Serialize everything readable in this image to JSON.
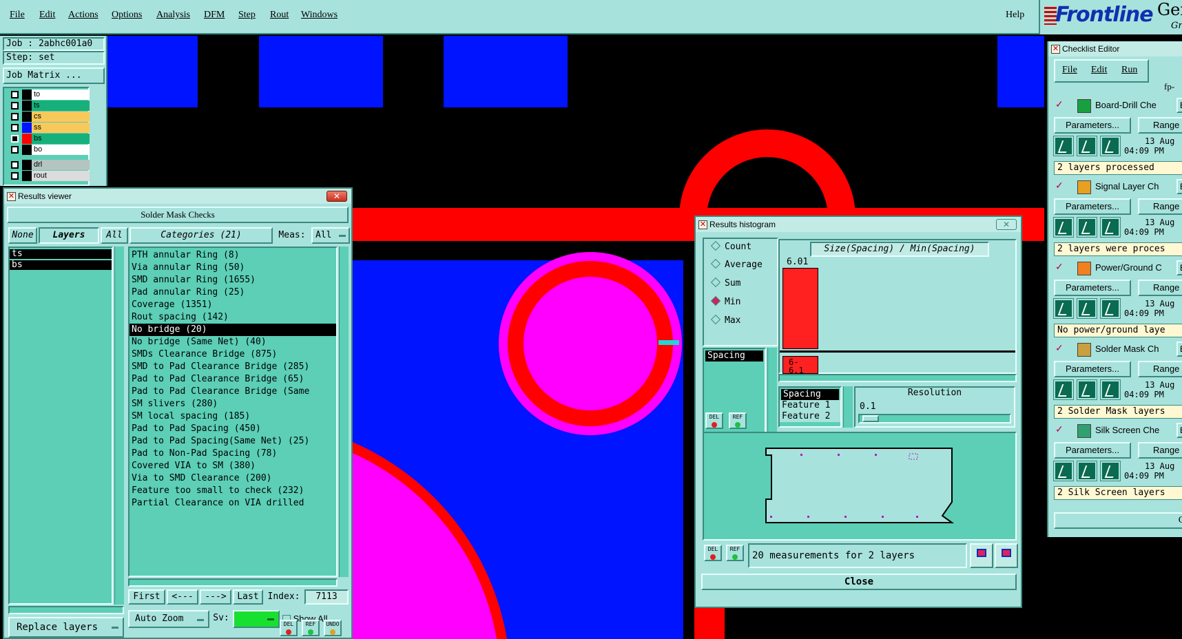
{
  "menubar": {
    "items": [
      "File",
      "Edit",
      "Actions",
      "Options",
      "Analysis",
      "DFM",
      "Step",
      "Rout",
      "Windows"
    ],
    "help": "Help"
  },
  "brand": {
    "logo": "Frontline",
    "gen": "Gen",
    "gr": "Gr"
  },
  "job": {
    "job_label": "Job : 2abhc001a0",
    "step_label": "Step: set",
    "matrix_button": "Job Matrix ..."
  },
  "layers": [
    {
      "name": "to",
      "color": "#ffffff"
    },
    {
      "name": "ts",
      "color": "#18b07a"
    },
    {
      "name": "cs",
      "color": "#f8c95a"
    },
    {
      "name": "ss",
      "color": "#f8c95a"
    },
    {
      "name": "bs",
      "color": "#18b07a"
    },
    {
      "name": "bo",
      "color": "#ffffff"
    },
    {
      "name": "drl",
      "color": "#b4c4c0"
    },
    {
      "name": "rout",
      "color": "#dcdcdc"
    }
  ],
  "results_viewer": {
    "title": "Results viewer",
    "header": "Solder Mask Checks",
    "none_btn": "None",
    "layers_btn": "Layers",
    "all_btn": "All",
    "categories_btn": "Categories (21)",
    "meas_label": "Meas:",
    "meas_value": "All",
    "layer_list": [
      "ts",
      "bs"
    ],
    "categories": [
      "PTH annular Ring (8)",
      "Via annular Ring (50)",
      "SMD annular Ring (1655)",
      "Pad annular Ring (25)",
      "Coverage (1351)",
      "Rout spacing (142)",
      "No bridge (20)",
      "No bridge (Same Net) (40)",
      "SMDs Clearance Bridge (875)",
      "SMD to Pad Clearance Bridge (285)",
      "Pad to Pad Clearance Bridge (65)",
      "Pad to Pad Clearance Bridge (Same",
      "SM slivers (280)",
      "SM local spacing (185)",
      "Pad to Pad Spacing (450)",
      "Pad to Pad Spacing(Same Net) (25)",
      "Pad to Non-Pad Spacing (78)",
      "Covered VIA to SM (380)",
      "Via to SMD Clearance (200)",
      "Feature too small to check (232)",
      "Partial Clearance on VIA drilled"
    ],
    "selected_category": "No bridge (20)",
    "nav": {
      "first": "First",
      "prev": "<---",
      "next": "--->",
      "last": "Last",
      "index_label": "Index:",
      "index_value": "7113"
    },
    "auto_zoom": "Auto Zoom",
    "sv_label": "Sv:",
    "show_all": "Show All",
    "replace_layers": "Replace layers",
    "del": "DEL",
    "ref": "REF",
    "undo": "UNDO"
  },
  "histogram": {
    "title": "Results histogram",
    "modes": [
      {
        "label": "Count",
        "on": false
      },
      {
        "label": "Average",
        "on": false
      },
      {
        "label": "Sum",
        "on": false
      },
      {
        "label": "Min",
        "on": true
      },
      {
        "label": "Max",
        "on": false
      }
    ],
    "measure_list": [
      "Spacing"
    ],
    "chart_title": "Size(Spacing) / Min(Spacing)",
    "bar_value_label": "6.01",
    "bin_label": "6-\n6.1",
    "axis_list": [
      "Spacing",
      "Feature 1",
      "Feature 2"
    ],
    "resolution_label": "Resolution",
    "resolution_value": "0.1",
    "status": "20 measurements for 2 layers",
    "close": "Close",
    "del": "DEL",
    "ref": "REF"
  },
  "checklist": {
    "title": "Checklist Editor",
    "menu": [
      "File",
      "Edit",
      "Run"
    ],
    "name_field": "fp-",
    "params_label": "Parameters...",
    "range_label": "Range",
    "er_label": "ER",
    "date_line1": "13 Aug",
    "date_line2": "04:09 PM",
    "close_label": "Cl",
    "sections": [
      {
        "name": "Board-Drill Che",
        "status": "2 layers processed",
        "icon_color": "#18a040"
      },
      {
        "name": "Signal Layer Ch",
        "status": "2 layers were proces",
        "icon_color": "#e8a020"
      },
      {
        "name": "Power/Ground C",
        "status": "No power/ground laye",
        "icon_color": "#f08020"
      },
      {
        "name": "Solder Mask Ch",
        "status": "2 Solder Mask layers",
        "icon_color": "#c8a040"
      },
      {
        "name": "Silk Screen Che",
        "status": "2 Silk Screen layers",
        "icon_color": "#30a070"
      }
    ]
  },
  "colors": {
    "panel": "#a8e2dc",
    "list": "#5ccfb6",
    "copper_red": "#ff0000",
    "pad_blue": "#0014ff",
    "mask_magenta": "#ff00ff"
  }
}
